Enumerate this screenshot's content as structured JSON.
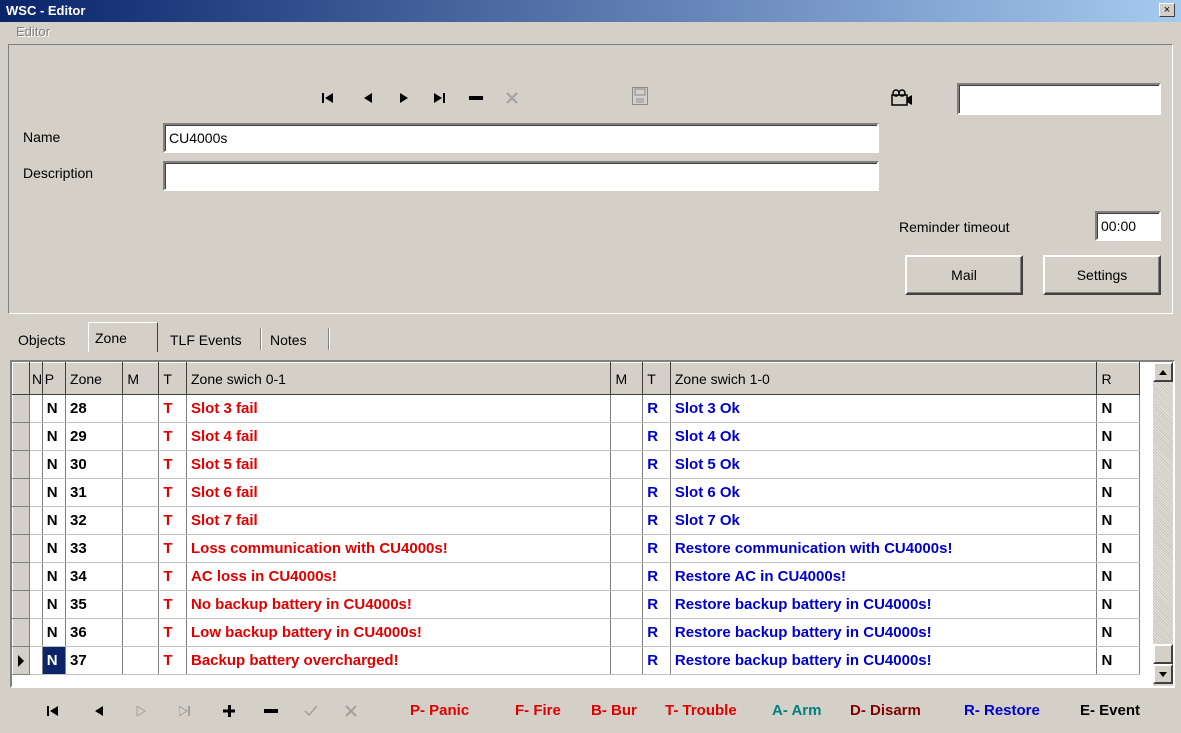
{
  "window": {
    "title": "WSC - Editor",
    "close_glyph": "×"
  },
  "menu": {
    "items": [
      "Editor"
    ]
  },
  "form": {
    "name_label": "Name",
    "name_value": "CU4000s",
    "description_label": "Description",
    "description_value": "",
    "camera_value": "",
    "reminder_label": "Reminder timeout",
    "reminder_value": "00:00",
    "mail_label": "Mail",
    "settings_label": "Settings"
  },
  "tabs": [
    "Objects",
    "Zone",
    "TLF Events",
    "Notes"
  ],
  "active_tab": "Zone",
  "grid": {
    "headers": [
      "N",
      "P",
      "Zone",
      "M",
      "T",
      "Zone swich 0-1",
      "M",
      "T",
      "Zone swich 1-0",
      "R"
    ],
    "rows": [
      {
        "p": "N",
        "zone": "28",
        "m1": "",
        "t1": "T",
        "sw01": "Slot 3 fail",
        "m2": "",
        "t2": "R",
        "sw10": "Slot 3 Ok",
        "r": "N"
      },
      {
        "p": "N",
        "zone": "29",
        "m1": "",
        "t1": "T",
        "sw01": "Slot 4 fail",
        "m2": "",
        "t2": "R",
        "sw10": "Slot 4 Ok",
        "r": "N"
      },
      {
        "p": "N",
        "zone": "30",
        "m1": "",
        "t1": "T",
        "sw01": "Slot 5 fail",
        "m2": "",
        "t2": "R",
        "sw10": "Slot 5 Ok",
        "r": "N"
      },
      {
        "p": "N",
        "zone": "31",
        "m1": "",
        "t1": "T",
        "sw01": "Slot 6 fail",
        "m2": "",
        "t2": "R",
        "sw10": "Slot 6 Ok",
        "r": "N"
      },
      {
        "p": "N",
        "zone": "32",
        "m1": "",
        "t1": "T",
        "sw01": "Slot 7 fail",
        "m2": "",
        "t2": "R",
        "sw10": "Slot 7 Ok",
        "r": "N"
      },
      {
        "p": "N",
        "zone": "33",
        "m1": "",
        "t1": "T",
        "sw01": "Loss communication with CU4000s!",
        "m2": "",
        "t2": "R",
        "sw10": "Restore communication with CU4000s!",
        "r": "N"
      },
      {
        "p": "N",
        "zone": "34",
        "m1": "",
        "t1": "T",
        "sw01": "AC loss in CU4000s!",
        "m2": "",
        "t2": "R",
        "sw10": "Restore AC in CU4000s!",
        "r": "N"
      },
      {
        "p": "N",
        "zone": "35",
        "m1": "",
        "t1": "T",
        "sw01": "No backup battery in CU4000s!",
        "m2": "",
        "t2": "R",
        "sw10": "Restore backup battery in CU4000s!",
        "r": "N"
      },
      {
        "p": "N",
        "zone": "36",
        "m1": "",
        "t1": "T",
        "sw01": "Low backup battery in CU4000s!",
        "m2": "",
        "t2": "R",
        "sw10": "Restore backup battery in CU4000s!",
        "r": "N"
      },
      {
        "p": "N",
        "zone": "37",
        "m1": "",
        "t1": "T",
        "sw01": "Backup battery overcharged!",
        "m2": "",
        "t2": "R",
        "sw10": "Restore backup battery in CU4000s!",
        "r": "N"
      }
    ],
    "current_row_index": 9
  },
  "legend": [
    {
      "text": "P- Panic",
      "color": "#e00000"
    },
    {
      "text": "F- Fire",
      "color": "#e00000"
    },
    {
      "text": "B- Bur",
      "color": "#e00000"
    },
    {
      "text": "T- Trouble",
      "color": "#e00000"
    },
    {
      "text": "A- Arm",
      "color": "#008080"
    },
    {
      "text": "D- Disarm",
      "color": "#800000"
    },
    {
      "text": "R- Restore",
      "color": "#0000cc"
    },
    {
      "text": "E- Event",
      "color": "#000000"
    }
  ],
  "colors": {
    "title_start": "#0a246a",
    "title_end": "#a6caf0",
    "face": "#d4d0c8",
    "trouble": "#e00000",
    "restore": "#0000cc"
  }
}
